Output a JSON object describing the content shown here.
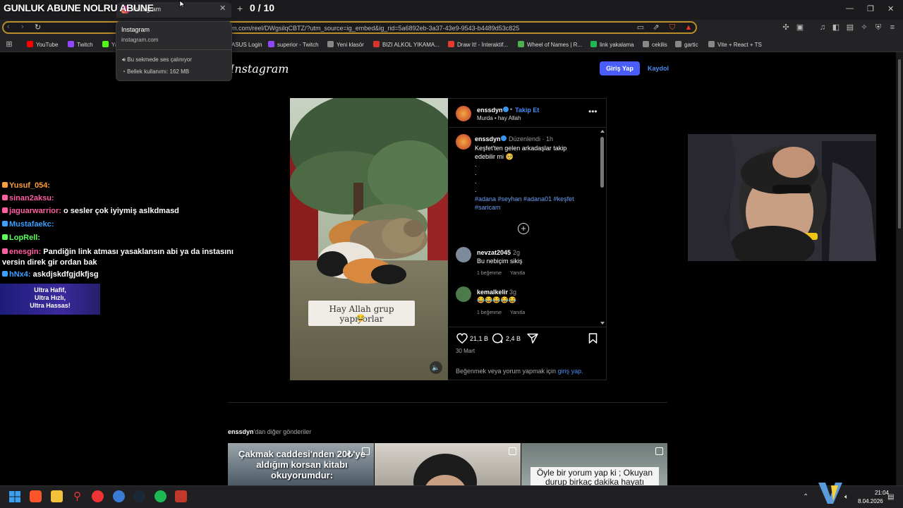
{
  "stream": {
    "title": "GUNLUK ABUNE NOLRU ABUNE",
    "counter": "0 / 10"
  },
  "browser": {
    "tab_title": "Instagram",
    "url": "m.com/reel/DWgsilqCBTZ/?utm_source=ig_embed&ig_rid=5a6892eb-3a37-43e9-9543-b4489d53c825",
    "hover_card": {
      "title": "Instagram",
      "domain": "instagram.com",
      "audio": "Bu sekmede ses çalınıyor",
      "memory": "Bellek kullanımı: 162 MB"
    },
    "bookmarks": [
      {
        "label": "YouTube",
        "color": "#ff0000"
      },
      {
        "label": "Twitch",
        "color": "#9146ff"
      },
      {
        "label": "Ya",
        "color": "#53fc18"
      },
      {
        "label": "ASUS Login",
        "color": "#444444"
      },
      {
        "label": "superior - Twitch",
        "color": "#9146ff"
      },
      {
        "label": "Yeni klasör",
        "color": "#888888"
      },
      {
        "label": "BIZI ALKOL YIKAMA...",
        "color": "#d9342b"
      },
      {
        "label": "Draw It! - İnteraktif...",
        "color": "#e33b2e"
      },
      {
        "label": "Wheel of Names | R...",
        "color": "#4caf50"
      },
      {
        "label": "link yakalama",
        "color": "#1db954"
      },
      {
        "label": "cekilis",
        "color": "#888888"
      },
      {
        "label": "gartic",
        "color": "#888888"
      },
      {
        "label": "Vite + React + TS",
        "color": "#888888"
      }
    ]
  },
  "instagram": {
    "logo": "Instagram",
    "login_button": "Giriş Yap",
    "signup_link": "Kaydol",
    "post": {
      "username": "enssdyn",
      "follow": "Takip Et",
      "audio": "Murda • hay Allah",
      "caption_user": "enssdyn",
      "caption_meta": "Düzenlendi · 1h",
      "caption_text": "Keşfet'ten gelen arkadaşlar takip edebilir mi 🥺",
      "caption_dots": [
        ".",
        ".",
        ".",
        "."
      ],
      "hashtags": "#adana #seyhan #adana01 #keşfet #saricam",
      "video_caption": "Hay Allah grup yapıyorlar",
      "video_emoji": "😂",
      "comments": [
        {
          "user": "nevzat2045",
          "time": "2g",
          "text": "Bu nebiçim sikiş",
          "likes": "1 beğenme",
          "reply": "Yanıtla"
        },
        {
          "user": "kemalkelir",
          "time": "3g",
          "text": "😂😂😂😂😂",
          "likes": "1 beğenme",
          "reply": "Yanıtla"
        }
      ],
      "like_count": "21,1 B",
      "comment_count": "2,4 B",
      "date": "30 Mart",
      "login_prompt": "Beğenmek veya yorum yapmak için",
      "login_prompt_link": "giriş yap."
    },
    "more_posts": {
      "user": "enssdyn",
      "suffix": "'dan diğer gönderiler",
      "thumbs": [
        {
          "text": "Çakmak caddesi'nden 20₺'ye aldığım korsan kitabı okuyorumdur:"
        },
        {
          "text": ""
        },
        {
          "text": "Öyle bir yorum yap ki ; Okuyan durup birkaç dakika hayatı sorgulasın"
        }
      ]
    }
  },
  "chat": [
    {
      "user": "Yusuf_054:",
      "msg": "",
      "color": "#ff9d3c"
    },
    {
      "user": "sinan2aksu:",
      "msg": "",
      "color": "#ff5ea1"
    },
    {
      "user": "jaguarwarrior:",
      "msg": "o sesler çok iyiymiş aslkdmasd",
      "color": "#ff5ea1"
    },
    {
      "user": "Mustafaekc:",
      "msg": "",
      "color": "#3aa0ff"
    },
    {
      "user": "LopRell:",
      "msg": "",
      "color": "#5aff5a"
    },
    {
      "user": "enesgin:",
      "msg": "Pandiğin link atması yasaklansın abi ya da instasını versin direk gir ordan bak",
      "color": "#ff5ea1"
    },
    {
      "user": "hNx4:",
      "msg": "askdjskdfgjdkfjsg",
      "color": "#3aa0ff"
    }
  ],
  "ad": {
    "line1": "Ultra Hafif,",
    "line2": "Ultra Hızlı,",
    "line3": "Ultra Hassas!"
  },
  "taskbar": {
    "time": "21:04",
    "date": "8.04.2026"
  },
  "colors": {
    "accent": "#4a5df9",
    "link": "#4a8cf9",
    "verified": "#3897f0"
  },
  "icons": [
    "windows-icon",
    "brave-icon",
    "folder-icon",
    "heart-icon",
    "comment-icon",
    "share-icon",
    "bookmark-icon",
    "plus-circle-icon",
    "more-icon",
    "mute-icon"
  ]
}
